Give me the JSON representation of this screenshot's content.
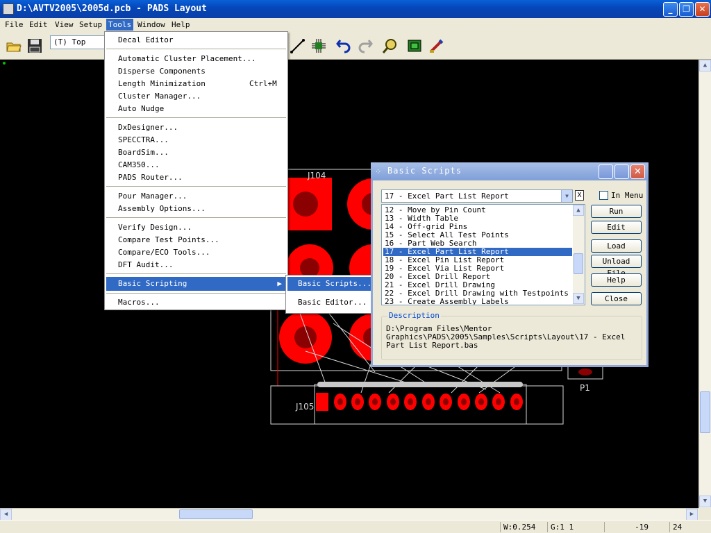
{
  "window": {
    "title": "D:\\AVTV2005\\2005d.pcb - PADS Layout"
  },
  "menubar": [
    "File",
    "Edit",
    "View",
    "Setup",
    "Tools",
    "Window",
    "Help"
  ],
  "toolbar": {
    "layer": "(T) Top"
  },
  "tools_menu": {
    "items": [
      {
        "label": "Decal Editor"
      },
      {
        "label": "Automatic Cluster Placement..."
      },
      {
        "label": "Disperse Components"
      },
      {
        "label": "Length Minimization",
        "shortcut": "Ctrl+M"
      },
      {
        "label": "Cluster Manager..."
      },
      {
        "label": "Auto Nudge"
      },
      {
        "label": "DxDesigner..."
      },
      {
        "label": "SPECCTRA..."
      },
      {
        "label": "BoardSim..."
      },
      {
        "label": "CAM350..."
      },
      {
        "label": "PADS Router..."
      },
      {
        "label": "Pour Manager..."
      },
      {
        "label": "Assembly Options..."
      },
      {
        "label": "Verify Design..."
      },
      {
        "label": "Compare Test Points..."
      },
      {
        "label": "Compare/ECO Tools..."
      },
      {
        "label": "DFT Audit..."
      },
      {
        "label": "Basic Scripting"
      },
      {
        "label": "Macros..."
      }
    ]
  },
  "submenu": [
    "Basic Scripts...",
    "Basic Editor..."
  ],
  "dialog": {
    "title": "Basic Scripts",
    "selected": "17 - Excel Part List Report",
    "x_label": "X",
    "in_menu": "In Menu",
    "list": [
      "12 - Move by Pin Count",
      "13 - Width Table",
      "14 - Off-grid Pins",
      "15 - Select All Test Points",
      "16 - Part Web Search",
      "17 - Excel Part List Report",
      "18 - Excel Pin List Report",
      "19 - Excel Via List Report",
      "20 - Excel Drill Report",
      "21 - Excel Drill Drawing",
      "22 - Excel Drill Drawing with Testpoints",
      "23 - Create Assembly Labels"
    ],
    "buttons": [
      "Run",
      "Edit",
      "Load File...",
      "Unload File",
      "Help",
      "Close"
    ],
    "description_title": "Description",
    "description": "D:\\Program Files\\Mentor Graphics\\PADS\\2005\\Samples\\Scripts\\Layout\\17 - Excel Part List Report.bas"
  },
  "pcb": {
    "labels": [
      "J104",
      "J105",
      "P1"
    ]
  },
  "status": {
    "w": "W:0.254",
    "g": "G:1 1",
    "x": "-19",
    "y": "24"
  },
  "colors": {
    "titlebar": "#0a46b8",
    "highlight": "#316ac5",
    "pad": "#ff0000",
    "canvas": "#000000"
  }
}
